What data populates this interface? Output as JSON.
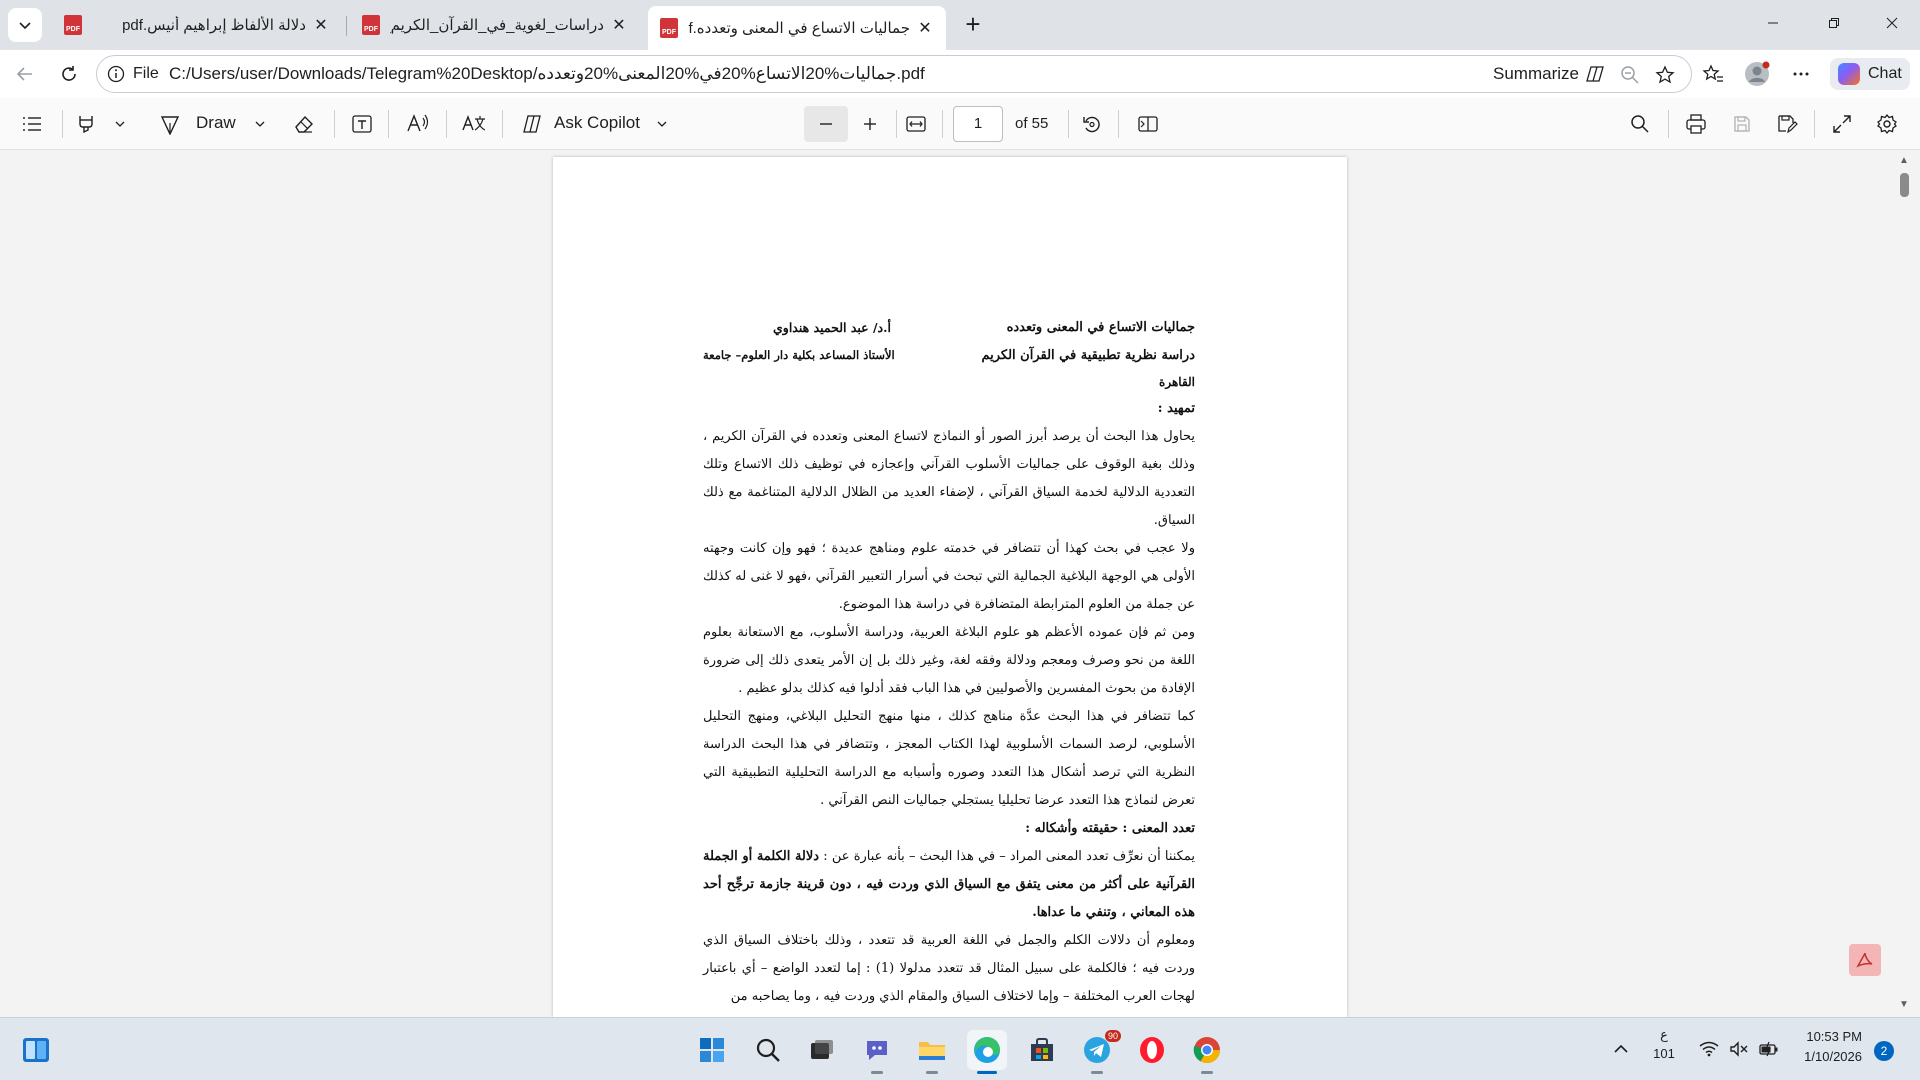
{
  "browser": {
    "tabs": [
      {
        "title": "دلالة الألفاظ إبراهيم أنيس.pdf",
        "active": false
      },
      {
        "title": "دراسات_لغوية_في_القرآن_الكريم_وقر",
        "active": false
      },
      {
        "title": "جماليات الاتساع في المعنى وتعدده.pdf",
        "active": true
      }
    ],
    "new_tab_symbol": "+",
    "address": {
      "scheme_label": "File",
      "url": "C:/Users/user/Downloads/Telegram%20Desktop/جماليات%20الاتساع%20في%20المعنى%20وتعدده.pdf",
      "summarize_label": "Summarize",
      "chat_label": "Chat"
    }
  },
  "pdf_toolbar": {
    "draw_label": "Draw",
    "ask_copilot_label": "Ask Copilot",
    "current_page": "1",
    "page_count_label": "of 55"
  },
  "document": {
    "title_line1": "جماليات الاتساع في المعنى وتعدده",
    "author": "أ.د/ عبد الحميد هنداوي",
    "title_line2": "دراسة نظرية تطبيقية في القرآن الكريم",
    "affiliation": "الأستاذ المساعد بكلية دار العلوم– جامعة",
    "affiliation_cont": "القاهرة",
    "intro_heading": "تمهيد :",
    "paragraphs": [
      "يحاول هذا البحث أن يرصد أبرز الصور أو النماذج لاتساع المعنى وتعدده في القرآن الكريم ، وذلك بغية الوقوف على جماليات الأسلوب القرآني وإعجازه في توظيف ذلك الاتساع وتلك التعددية الدلالية لخدمة السياق القرآني ، لإضفاء العديد من الظلال الدلالية المتناغمة مع ذلك السياق.",
      "ولا عجب في بحث كهذا أن تتضافر في خدمته علوم ومناهج عديدة ؛ فهو وإن كانت وجهته الأولى هي الوجهة البلاغية الجمالية التي تبحث في أسرار التعبير القرآني ،فهو لا غنى له كذلك عن جملة من العلوم المترابطة المتضافرة في دراسة هذا الموضوع.",
      "ومن ثم فإن عموده الأعظم هو علوم البلاغة العربية، ودراسة الأسلوب، مع الاستعانة بعلوم اللغة من نحو وصرف ومعجم ودلالة وفقه لغة، وغير ذلك بل إن الأمر يتعدى ذلك إلى ضرورة الإفادة من بحوث المفسرين والأصوليين في هذا الباب فقد أدلوا فيه كذلك بدلو عظيم .",
      "كما تتضافر في هذا البحث عدَّة مناهج كذلك ، منها منهج التحليل البلاغي، ومنهج التحليل الأسلوبي، لرصد السمات الأسلوبية لهذا الكتاب المعجز ، وتتضافر في هذا البحث الدراسة النظرية التي ترصد أشكال هذا التعدد وصوره وأسبابه مع الدراسة التحليلية التطبيقية التي تعرض لنماذج هذا التعدد عرضا تحليليا يستجلي جماليات النص القرآني ."
    ],
    "section_heading": "تعدد المعنى : حقيقته وأشكاله :",
    "definition_intro": "يمكننا أن نعرِّف تعدد المعنى المراد – في هذا البحث – بأنه عبارة عن :",
    "definition_bold": "دلالة الكلمة أو الجملة القرآنية على أكثر من معنى يتفق مع السياق الذي وردت فيه ، دون قرينة جازمة ترجِّح أحد هذه المعاني ، وتنفي ما عداها.",
    "last_paragraph": "ومعلوم أن دلالات الكلم والجمل في اللغة العربية قد تتعدد ، وذلك باختلاف السياق الذي وردت فيه ؛ فالكلمة على سبيل المثال قد تتعدد مدلولا (1) : إما لتعدد الواضع – أي باعتبار لهجات العرب المختلفة – وإما لاختلاف السياق والمقام الذي وردت فيه ، وما يصاحبه من"
  },
  "taskbar": {
    "telegram_badge": "90",
    "lang_line1": "ع",
    "lang_line2": "101",
    "time": "10:53 PM",
    "date": "1/10/2026",
    "notification_count": "2"
  },
  "colors": {
    "pdf_red": "#d13438",
    "accent_blue": "#0067c0",
    "tab_strip": "#dfe3e8",
    "viewer_bg": "#f3f3f3"
  }
}
